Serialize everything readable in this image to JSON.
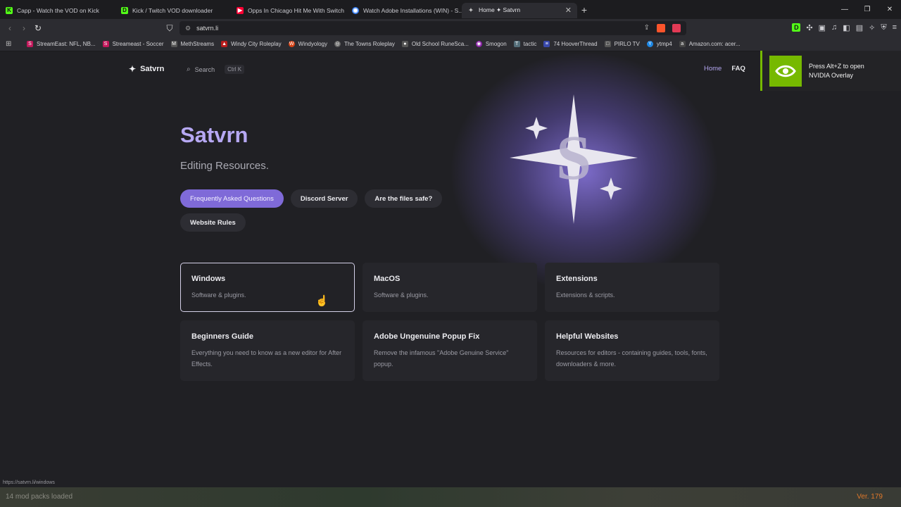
{
  "tabs": [
    {
      "title": "Capp - Watch the VOD on Kick",
      "fav": "K",
      "color": "#53fc18"
    },
    {
      "title": "Kick / Twitch VOD downloader",
      "fav": "D",
      "color": "#53fc18"
    },
    {
      "title": "Opps In Chicago Hit Me With Switch",
      "fav": "▶",
      "color": "#ff0033"
    },
    {
      "title": "Watch Adobe Installations (WIN) - S...",
      "fav": "◉",
      "color": "#3b82f6"
    },
    {
      "title": "Home ✦ Satvrn",
      "fav": "✦",
      "color": "#cccccc",
      "active": true
    }
  ],
  "url": "satvrn.li",
  "bookmarks": [
    {
      "label": "StreamEast: NFL, NB...",
      "color": "#c2185b",
      "glyph": "S"
    },
    {
      "label": "Streameast - Soccer",
      "color": "#c2185b",
      "glyph": "S"
    },
    {
      "label": "MethStreams",
      "color": "#555",
      "glyph": "M"
    },
    {
      "label": "Windy City Roleplay",
      "color": "#b71c1c",
      "glyph": "▲"
    },
    {
      "label": "Windyology",
      "color": "#d84315",
      "glyph": "W"
    },
    {
      "label": "The Towns Roleplay",
      "color": "#666",
      "glyph": "◎"
    },
    {
      "label": "Old School RuneSca...",
      "color": "#555",
      "glyph": "●"
    },
    {
      "label": "Smogon",
      "color": "#8e24aa",
      "glyph": "◉"
    },
    {
      "label": "tactic",
      "color": "#546e7a",
      "glyph": "T"
    },
    {
      "label": "74 HooverThread",
      "color": "#3949ab",
      "glyph": "≡"
    },
    {
      "label": "PIRLO TV",
      "color": "#555",
      "glyph": "□"
    },
    {
      "label": "ytmp4",
      "color": "#1e88e5",
      "glyph": "Y"
    },
    {
      "label": "Amazon.com: acer...",
      "color": "#444",
      "glyph": "a"
    }
  ],
  "site": {
    "logo": "Satvrn",
    "search_label": "Search",
    "search_shortcut": "Ctrl K",
    "nav_home": "Home",
    "nav_faq": "FAQ"
  },
  "hero": {
    "title": "Satvrn",
    "subtitle": "Editing Resources.",
    "buttons": [
      "Frequently Asked Questions",
      "Discord Server",
      "Are the files safe?"
    ],
    "button_rules": "Website Rules"
  },
  "cards": [
    {
      "title": "Windows",
      "desc": "Software & plugins."
    },
    {
      "title": "MacOS",
      "desc": "Software & plugins."
    },
    {
      "title": "Extensions",
      "desc": "Extensions & scripts."
    },
    {
      "title": "Beginners Guide",
      "desc": "Everything you need to know as a new editor for After Effects."
    },
    {
      "title": "Adobe Ungenuine Popup Fix",
      "desc": "Remove the infamous \"Adobe Genuine Service\" popup."
    },
    {
      "title": "Helpful Websites",
      "desc": "Resources for editors - containing guides, tools, fonts, downloaders & more."
    }
  ],
  "status_url": "https://satvrn.li/windows",
  "nvidia": {
    "line1": "Press Alt+Z to open",
    "line2": "NVIDIA Overlay"
  },
  "overlay": {
    "mods": "14 mod packs loaded",
    "version": "Ver. 179"
  }
}
